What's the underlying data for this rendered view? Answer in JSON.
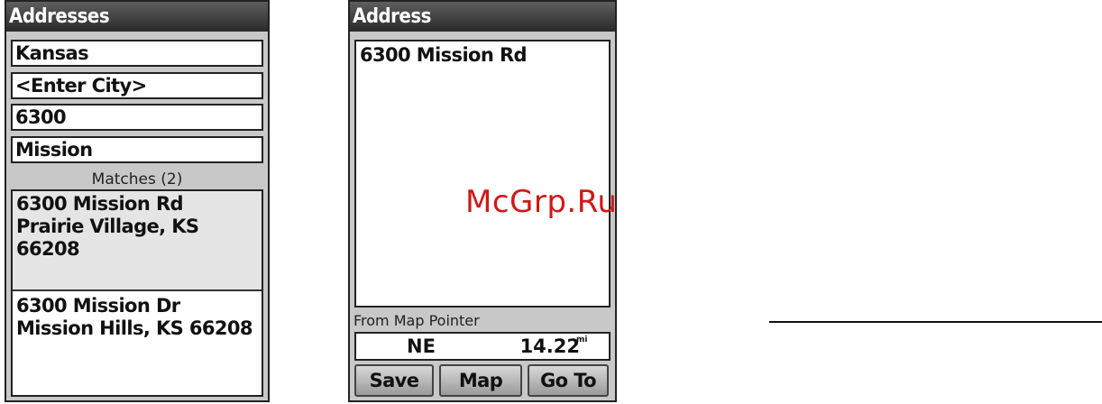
{
  "left_screen": {
    "title": "Addresses",
    "fields": [
      "Kansas",
      "<Enter City>",
      "6300",
      "Mission"
    ],
    "matches_label": "Matches (2)",
    "matches": [
      {
        "line1": "6300 Mission Rd",
        "line2": "Prairie Village, KS",
        "line3": "66208"
      },
      {
        "line1": "6300 Mission Dr",
        "line2": "Mission Hills, KS 66208"
      }
    ]
  },
  "right_screen": {
    "title": "Address",
    "address": "6300 Mission Rd",
    "from_label": "From Map Pointer",
    "bearing": "NE",
    "distance": "14.22",
    "distance_unit": "mi",
    "buttons": {
      "save": "Save",
      "map": "Map",
      "goto": "Go To"
    }
  },
  "watermark": "McGrp.Ru"
}
